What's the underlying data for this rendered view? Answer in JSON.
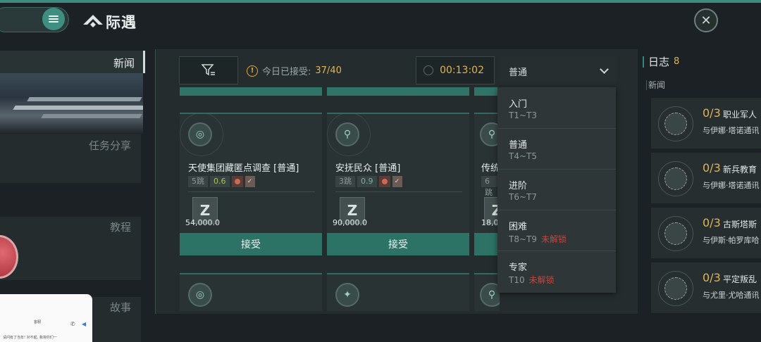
{
  "header": {
    "title": "际遇"
  },
  "sidebar": {
    "items": [
      {
        "label": "新闻"
      },
      {
        "label": "任务分享"
      },
      {
        "label": "教程"
      },
      {
        "label": "故事"
      }
    ]
  },
  "toolbar": {
    "accept_label": "今日已接受:",
    "accept_value": "37/40",
    "timer": "00:13:02",
    "difficulty_selected": "普通"
  },
  "cards": [
    {
      "title": "天使集团藏匿点调查 [普通]",
      "jumps": "5跳",
      "security": "0.6",
      "reward": "54,000.0",
      "accept": "接受"
    },
    {
      "title": "安抚民众 [普通]",
      "jumps": "3跳",
      "security": "0.9",
      "reward": "90,000.0",
      "accept": "接受"
    },
    {
      "title": "传统",
      "jumps": "6跳",
      "security": "",
      "reward": "18,0",
      "accept": ""
    }
  ],
  "dropdown": [
    {
      "name": "入门",
      "range": "T1~T3",
      "lock": ""
    },
    {
      "name": "普通",
      "range": "T4~T5",
      "lock": ""
    },
    {
      "name": "进阶",
      "range": "T6~T7",
      "lock": ""
    },
    {
      "name": "困难",
      "range": "T8~T9",
      "lock": "未解锁"
    },
    {
      "name": "专家",
      "range": "T10",
      "lock": "未解锁"
    }
  ],
  "log": {
    "title": "日志",
    "count": "8",
    "section": "新闻",
    "items": [
      {
        "progress": "0/3",
        "name": "职业军人",
        "desc": "与伊娜·塔诺通讯"
      },
      {
        "progress": "0/3",
        "name": "新兵教育",
        "desc": "与伊娜·塔诺通讯"
      },
      {
        "progress": "0/3",
        "name": "古斯塔斯",
        "desc": "与伊斯·帕罗库哈"
      },
      {
        "progress": "0/3",
        "name": "平定叛乱",
        "desc": "与尤里·尤哈通讯"
      }
    ]
  },
  "chat": {
    "line1": "客服",
    "line2": "请问有了当年! 对不起, 我将你们一"
  }
}
